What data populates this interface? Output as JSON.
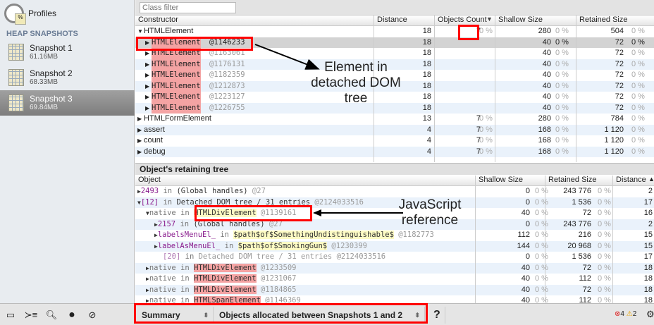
{
  "sidebar": {
    "title": "Profiles",
    "section": "HEAP SNAPSHOTS",
    "snapshots": [
      {
        "name": "Snapshot 1",
        "size": "61.16MB"
      },
      {
        "name": "Snapshot 2",
        "size": "68.33MB"
      },
      {
        "name": "Snapshot 3",
        "size": "69.84MB",
        "selected": true
      }
    ]
  },
  "filter": {
    "placeholder": "Class filter"
  },
  "top": {
    "columns": [
      "Constructor",
      "Distance",
      "Objects Count",
      "Shallow Size",
      "Retained Size"
    ],
    "rows": [
      {
        "name": "HTMLElement",
        "expanded": true,
        "distance": "18",
        "count": "7",
        "count_pct": "0 %",
        "shallow": "280",
        "shallow_pct": "0 %",
        "retained": "504",
        "retained_pct": "0 %"
      },
      {
        "name": "HTMLElement",
        "id": "@1146233",
        "child": true,
        "selected": true,
        "distance": "18",
        "shallow": "40",
        "shallow_pct": "0 %",
        "retained": "72",
        "retained_pct": "0 %"
      },
      {
        "name": "HTMLElement",
        "id": "@1163061",
        "child": true,
        "distance": "18",
        "shallow": "40",
        "shallow_pct": "0 %",
        "retained": "72",
        "retained_pct": "0 %"
      },
      {
        "name": "HTMLElement",
        "id": "@1176131",
        "child": true,
        "distance": "18",
        "shallow": "40",
        "shallow_pct": "0 %",
        "retained": "72",
        "retained_pct": "0 %"
      },
      {
        "name": "HTMLElement",
        "id": "@1182359",
        "child": true,
        "distance": "18",
        "shallow": "40",
        "shallow_pct": "0 %",
        "retained": "72",
        "retained_pct": "0 %"
      },
      {
        "name": "HTMLElement",
        "id": "@1212873",
        "child": true,
        "distance": "18",
        "shallow": "40",
        "shallow_pct": "0 %",
        "retained": "72",
        "retained_pct": "0 %"
      },
      {
        "name": "HTMLElement",
        "id": "@1223127",
        "child": true,
        "distance": "18",
        "shallow": "40",
        "shallow_pct": "0 %",
        "retained": "72",
        "retained_pct": "0 %"
      },
      {
        "name": "HTMLElement",
        "id": "@1226755",
        "child": true,
        "distance": "18",
        "shallow": "40",
        "shallow_pct": "0 %",
        "retained": "72",
        "retained_pct": "0 %"
      },
      {
        "name": "HTMLFormElement",
        "distance": "13",
        "count": "7",
        "count_pct": "0 %",
        "shallow": "280",
        "shallow_pct": "0 %",
        "retained": "784",
        "retained_pct": "0 %"
      },
      {
        "name": "assert",
        "distance": "4",
        "count": "7",
        "count_pct": "0 %",
        "shallow": "168",
        "shallow_pct": "0 %",
        "retained": "1 120",
        "retained_pct": "0 %"
      },
      {
        "name": "count",
        "distance": "4",
        "count": "7",
        "count_pct": "0 %",
        "shallow": "168",
        "shallow_pct": "0 %",
        "retained": "1 120",
        "retained_pct": "0 %"
      },
      {
        "name": "debug",
        "distance": "4",
        "count": "7",
        "count_pct": "0 %",
        "shallow": "168",
        "shallow_pct": "0 %",
        "retained": "1 120",
        "retained_pct": "0 %"
      }
    ]
  },
  "retaining": {
    "title": "Object's retaining tree",
    "columns": [
      "Object",
      "Shallow Size",
      "Retained Size",
      "Distance"
    ],
    "rows": [
      {
        "level": 0,
        "arrow": "▶",
        "edge": "2493",
        "edge_color": "purple",
        "in": "in",
        "target": "(Global handles)",
        "id": "@27",
        "shallow": "0",
        "shallow_pct": "0 %",
        "retained": "243 776",
        "retained_pct": "0 %",
        "distance": "2"
      },
      {
        "level": 0,
        "arrow": "▼",
        "edge": "[12]",
        "edge_color": "purple",
        "in": "in",
        "target": "Detached DOM tree / 31 entries",
        "id": "@2124033516",
        "shallow": "0",
        "shallow_pct": "0 %",
        "retained": "1 536",
        "retained_pct": "0 %",
        "distance": "17"
      },
      {
        "level": 1,
        "arrow": "▼",
        "edge": "native",
        "edge_color": "gray",
        "in": "in",
        "target": "HTMLDivElement",
        "hl": "yel",
        "id": "@1139161",
        "shallow": "40",
        "shallow_pct": "0 %",
        "retained": "72",
        "retained_pct": "0 %",
        "distance": "16"
      },
      {
        "level": 2,
        "arrow": "▶",
        "edge": "2157",
        "edge_color": "purple",
        "in": "in",
        "target": "(Global handles)",
        "id": "@27",
        "shallow": "0",
        "shallow_pct": "0 %",
        "retained": "243 776",
        "retained_pct": "0 %",
        "distance": "2"
      },
      {
        "level": 2,
        "arrow": "▶",
        "edge": "labelsMenuEl_",
        "edge_color": "purple",
        "in": "in",
        "target": "$path$of$SomethingUndistinguishable$",
        "hl": "yel",
        "id": "@1182773",
        "shallow": "112",
        "shallow_pct": "0 %",
        "retained": "216",
        "retained_pct": "0 %",
        "distance": "15"
      },
      {
        "level": 2,
        "arrow": "▶",
        "edge": "labelAsMenuEl_",
        "edge_color": "purple",
        "in": "in",
        "target": "$path$of$SmokingGun$",
        "hl": "yel",
        "id": "@1230399",
        "shallow": "144",
        "shallow_pct": "0 %",
        "retained": "20 968",
        "retained_pct": "0 %",
        "distance": "15"
      },
      {
        "level": 2,
        "arrow": "",
        "edge": "[20]",
        "edge_color": "lightpurple",
        "in": "in",
        "target": "Detached DOM tree / 31 entries",
        "id": "@2124033516",
        "shallow": "0",
        "shallow_pct": "0 %",
        "retained": "1 536",
        "retained_pct": "0 %",
        "distance": "17",
        "dim": true
      },
      {
        "level": 1,
        "arrow": "▶",
        "edge": "native",
        "edge_color": "gray",
        "in": "in",
        "target": "HTMLDivElement",
        "hl": "red",
        "id": "@1233509",
        "shallow": "40",
        "shallow_pct": "0 %",
        "retained": "72",
        "retained_pct": "0 %",
        "distance": "18"
      },
      {
        "level": 1,
        "arrow": "▶",
        "edge": "native",
        "edge_color": "gray",
        "in": "in",
        "target": "HTMLDivElement",
        "hl": "red",
        "id": "@1231067",
        "shallow": "40",
        "shallow_pct": "0 %",
        "retained": "112",
        "retained_pct": "0 %",
        "distance": "18"
      },
      {
        "level": 1,
        "arrow": "▶",
        "edge": "native",
        "edge_color": "gray",
        "in": "in",
        "target": "HTMLDivElement",
        "hl": "red",
        "id": "@1184865",
        "shallow": "40",
        "shallow_pct": "0 %",
        "retained": "72",
        "retained_pct": "0 %",
        "distance": "18"
      },
      {
        "level": 1,
        "arrow": "▶",
        "edge": "native",
        "edge_color": "gray",
        "in": "in",
        "target": "HTMLSpanElement",
        "hl": "red",
        "id": "@1146369",
        "shallow": "40",
        "shallow_pct": "0 %",
        "retained": "112",
        "retained_pct": "0 %",
        "distance": "18"
      }
    ]
  },
  "status": {
    "icons": [
      "dock-icon",
      "console-icon",
      "search-icon",
      "record-icon",
      "clear-icon"
    ],
    "view": "Summary",
    "range": "Objects allocated between Snapshots 1 and 2",
    "help": "?",
    "errors": "4",
    "warnings": "2"
  },
  "annotations": {
    "element": "Element in detached DOM tree",
    "js": "JavaScript reference"
  },
  "colors": {
    "highlight_red": "#f4a3a3",
    "highlight_yellow": "#fdfbc4",
    "annotation": "#ff0000",
    "purple": "#8a1d8e"
  }
}
